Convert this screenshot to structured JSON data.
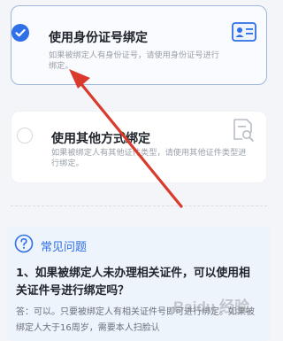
{
  "option_id_card": {
    "title": "使用身份证号绑定",
    "desc": "如果被绑定人有身份证号，请使用身份证号进行绑定。",
    "icon": "id-card-icon",
    "selected": true
  },
  "option_other": {
    "title": "使用其他方式绑定",
    "desc": "如果被绑定人有其他证件类型，请使用其他证件类型进行绑定。",
    "icon": "document-search-icon",
    "selected": false
  },
  "faq": {
    "title": "常见问题",
    "icon": "question-circle-icon",
    "question": "1、如果被绑定人未办理相关证件，可以使用相关证件号进行绑定吗？",
    "answer": "答：可以。只要被绑定人有相关证件号即可进行绑定。如果被绑定人大于16周岁，需要本人扫脸认"
  },
  "watermark": {
    "text": "Baidu 经验"
  },
  "colors": {
    "accent": "#2f6fe8",
    "annotation_arrow": "#d93a2b"
  }
}
